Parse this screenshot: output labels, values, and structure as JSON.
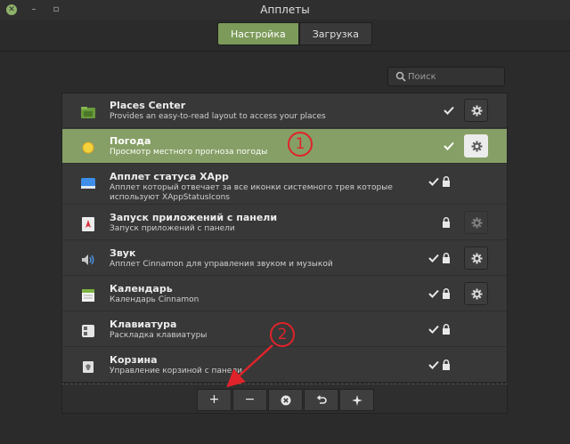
{
  "window": {
    "title": "Апплеты"
  },
  "tabs": [
    {
      "label": "Настройка",
      "active": true
    },
    {
      "label": "Загрузка",
      "active": false
    }
  ],
  "search": {
    "placeholder": "Поиск"
  },
  "applets": [
    {
      "name": "Places Center",
      "desc": "Provides an easy-to-read layout to access your places",
      "icon": "folder-icon",
      "enabled": true,
      "locked": false,
      "configurable": true,
      "selected": false
    },
    {
      "name": "Погода",
      "desc": "Просмотр местного прогноза погоды",
      "icon": "weather-sun-icon",
      "enabled": true,
      "locked": false,
      "configurable": true,
      "selected": true
    },
    {
      "name": "Апплет статуса XApp",
      "desc": "Апплет который отвечает за все иконки системного трея которые используют XAppStatusIcons",
      "icon": "status-tray-icon",
      "enabled": true,
      "locked": true,
      "configurable": false,
      "selected": false
    },
    {
      "name": "Запуск приложений с панели",
      "desc": "Запуск приложений с панели",
      "icon": "panel-launcher-icon",
      "enabled": false,
      "locked": true,
      "configurable": true,
      "cfg_disabled": true,
      "selected": false
    },
    {
      "name": "Звук",
      "desc": "Апплет Cinnamon для управления звуком и музыкой",
      "icon": "sound-icon",
      "enabled": true,
      "locked": true,
      "configurable": true,
      "selected": false
    },
    {
      "name": "Календарь",
      "desc": "Календарь Cinnamon",
      "icon": "calendar-icon",
      "enabled": true,
      "locked": true,
      "configurable": true,
      "selected": false
    },
    {
      "name": "Клавиатура",
      "desc": "Раскладка клавиатуры",
      "icon": "keyboard-icon",
      "enabled": true,
      "locked": true,
      "configurable": false,
      "selected": false
    },
    {
      "name": "Корзина",
      "desc": "Управление корзиной с панели",
      "icon": "trash-icon",
      "enabled": true,
      "locked": true,
      "configurable": false,
      "selected": false
    }
  ],
  "toolbar": {
    "add_label": "+",
    "remove_label": "−"
  },
  "annotations": [
    {
      "label": "1"
    },
    {
      "label": "2"
    }
  ],
  "colors": {
    "accent": "#7c9a5a",
    "selected_row": "#869f66",
    "annotation": "#e0232a"
  }
}
